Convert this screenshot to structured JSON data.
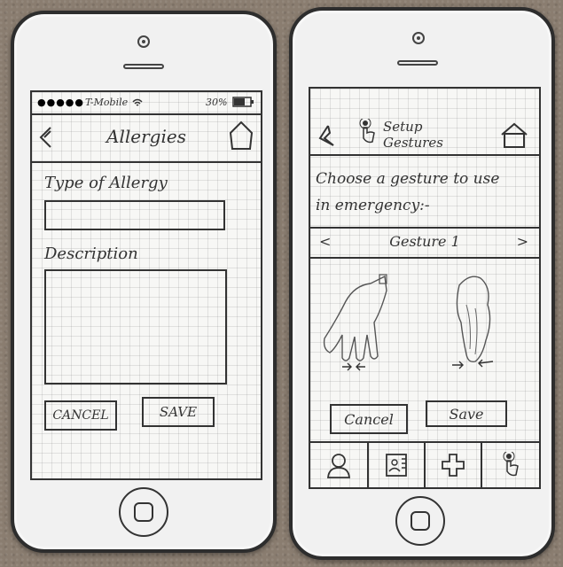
{
  "left_screen": {
    "status": {
      "carrier": "T-Mobile",
      "battery": "30%"
    },
    "nav": {
      "title": "Allergies"
    },
    "form": {
      "type_label": "Type of Allergy",
      "type_value": "",
      "description_label": "Description",
      "description_value": ""
    },
    "buttons": {
      "cancel": "CANCEL",
      "save": "SAVE"
    }
  },
  "right_screen": {
    "nav": {
      "title_line1": "Setup",
      "title_line2": "Gestures"
    },
    "prompt": {
      "line1": "Choose a gesture to use",
      "line2": "in emergency:-"
    },
    "selector": {
      "prev": "<",
      "label": "Gesture 1",
      "next": ">"
    },
    "buttons": {
      "cancel": "Cancel",
      "save": "Save"
    },
    "tabs": [
      "profile-icon",
      "contacts-icon",
      "medical-cross-icon",
      "gesture-icon"
    ]
  }
}
